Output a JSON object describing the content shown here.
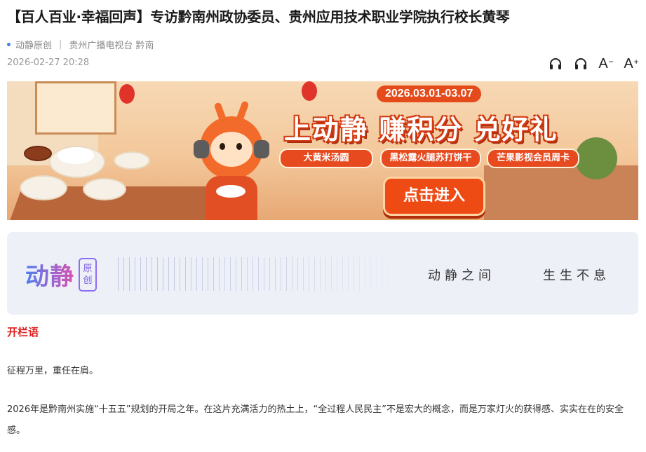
{
  "article": {
    "title": "【百人百业·幸福回声】专访黔南州政协委员、贵州应用技术职业学院执行校长黄琴",
    "source": "动静原创",
    "separator": "|",
    "channel": "贵州广播电视台 黔南",
    "date": "2026-02-27 20:28"
  },
  "toolbar": {
    "icons": [
      "headphones-icon",
      "headphones-icon"
    ],
    "font_decrease": "A",
    "font_decrease_mark": "−",
    "font_increase": "A",
    "font_increase_mark": "+"
  },
  "banner": {
    "date_range": "2026.03.01-03.07",
    "headline": "上动静 赚积分 兑好礼",
    "tags": [
      "大黄米汤圆",
      "黑松露火腿苏打饼干",
      "芒果影视会员周卡"
    ],
    "cta": "点击进入"
  },
  "brand": {
    "logo_text": "动静",
    "logo_badge_1": "原",
    "logo_badge_2": "创",
    "slogan_1": "动静之间",
    "slogan_2": "生生不息"
  },
  "body": {
    "section_title": "开栏语",
    "paragraphs": [
      "征程万里，重任在肩。",
      "2026年是黔南州实施“十五五”规划的开局之年。在这片充满活力的热土上，“全过程人民民主”不是宏大的概念，而是万家灯火的获得感、实实在在的安全感。"
    ]
  },
  "colors": {
    "accent_red": "#e02020",
    "banner_orange": "#e54a1a",
    "link_blue": "#4a7df0"
  }
}
